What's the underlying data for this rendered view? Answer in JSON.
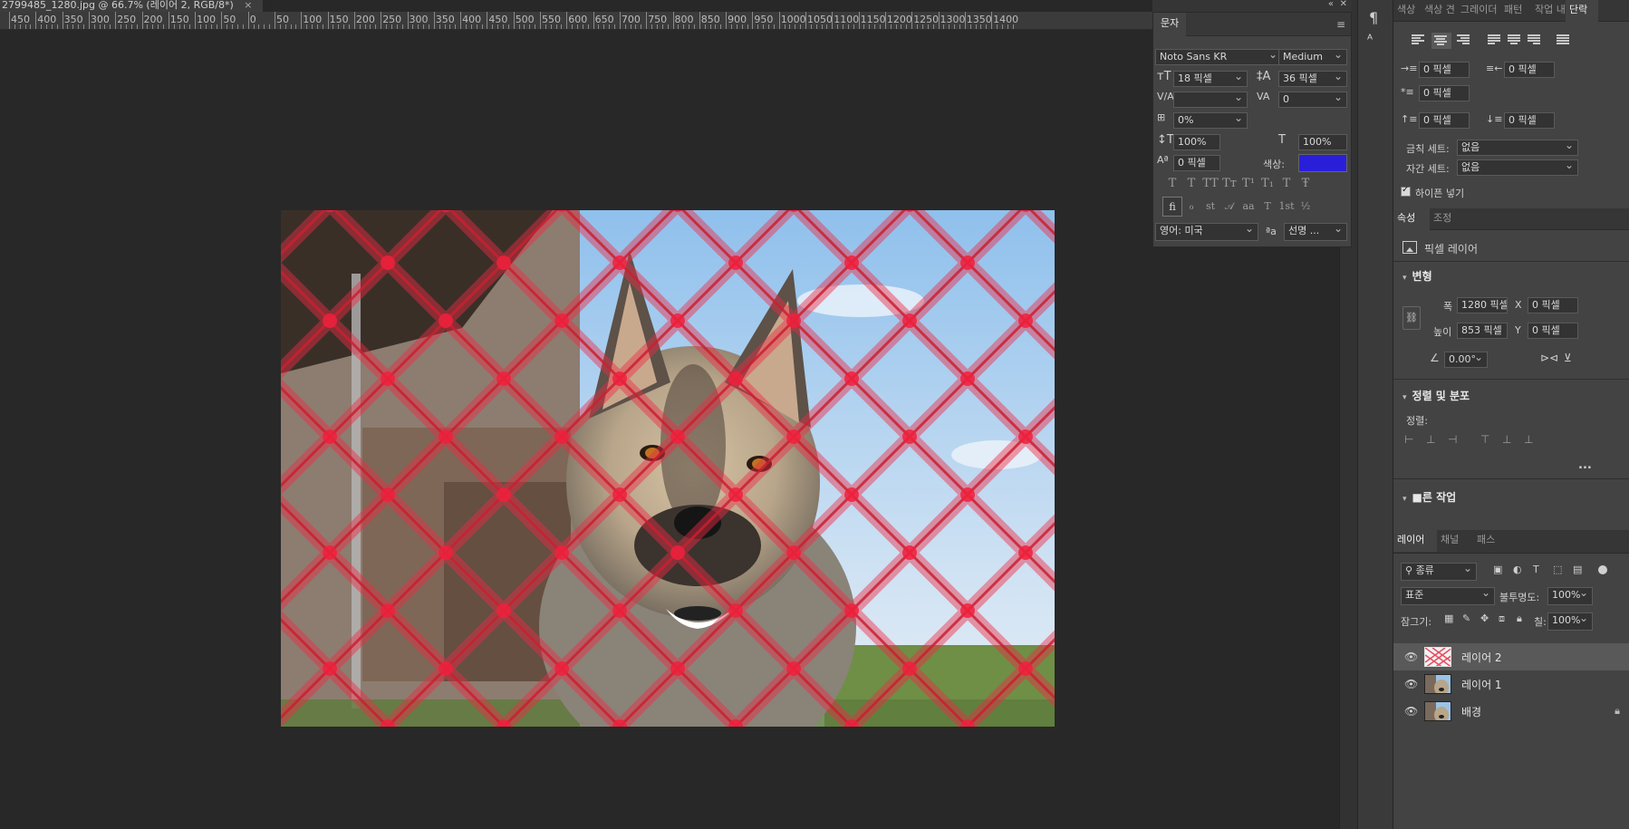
{
  "document": {
    "tab_title": "2799485_1280.jpg @ 66.7% (레이어 2, RGB/8*)",
    "close_glyph": "×"
  },
  "ruler": {
    "labels": [
      "450",
      "400",
      "350",
      "300",
      "250",
      "200",
      "150",
      "100",
      "50",
      "0",
      "50",
      "100",
      "150",
      "200",
      "250",
      "300",
      "350",
      "400",
      "450",
      "500",
      "550",
      "600",
      "650",
      "700",
      "750",
      "800",
      "850",
      "900",
      "950",
      "1000",
      "1050",
      "1100",
      "1150",
      "1200",
      "1250",
      "1300",
      "1350",
      "1400"
    ]
  },
  "character_panel": {
    "title": "문자",
    "font_family": "Noto Sans KR",
    "font_style": "Medium",
    "font_size": "18 픽셀",
    "leading": "36 픽셀",
    "kerning": "",
    "tracking": "0",
    "tsume": "0%",
    "vertical_scale": "100%",
    "horizontal_scale": "100%",
    "baseline_shift": "0 픽셀",
    "color_label": "색상:",
    "color_value": "#2a1fd8",
    "type_buttons": [
      "T",
      "T",
      "TT",
      "Tт",
      "T¹",
      "T₁",
      "T",
      "Ŧ"
    ],
    "opentype_buttons": [
      "ﬁ",
      "ℴ",
      "st",
      "𝒜",
      "aa",
      "T",
      "1st",
      "½"
    ],
    "language": "영어: 미국",
    "antialias_label": "ªa",
    "antialias": "선명 ..."
  },
  "paragraph_panel": {
    "tabs": [
      "색상",
      "색상 견",
      "그레이더",
      "패턴",
      "작업 내",
      "단락"
    ],
    "active_tab": "단락",
    "indent_left": "0 픽셀",
    "indent_right": "0 픽셀",
    "indent_first": "0 픽셀",
    "space_before": "0 픽셀",
    "space_after": "0 픽셀",
    "kinsoku_label": "금칙 세트:",
    "kinsoku_value": "없음",
    "mojikumi_label": "자간 세트:",
    "mojikumi_value": "없음",
    "hyphenate_label": "하이픈 넣기",
    "hyphenate_checked": true
  },
  "properties_panel": {
    "tabs": [
      "속성",
      "조정"
    ],
    "layer_type": "픽셀 레이어",
    "transform_title": "변형",
    "width_label": "폭",
    "width_value": "1280 픽셀",
    "height_label": "높이",
    "height_value": "853 픽셀",
    "x_label": "X",
    "x_value": "0 픽셀",
    "y_label": "Y",
    "y_value": "0 픽셀",
    "angle_value": "0.00°",
    "align_title": "정렬 및 분포",
    "align_label": "정렬:",
    "more_glyph": "...",
    "quick_actions_title": "■른 작업"
  },
  "layers_panel": {
    "tabs": [
      "레이어",
      "채널",
      "패스"
    ],
    "filter_kind": "종류",
    "blend_mode": "표준",
    "opacity_label": "불투명도:",
    "opacity_value": "100%",
    "lock_label": "잠그기:",
    "fill_label": "칠:",
    "fill_value": "100%",
    "layers": [
      {
        "name": "레이어 2",
        "selected": true,
        "locked": false
      },
      {
        "name": "레이어 1",
        "selected": false,
        "locked": false
      },
      {
        "name": "배경",
        "selected": false,
        "locked": true
      }
    ]
  }
}
